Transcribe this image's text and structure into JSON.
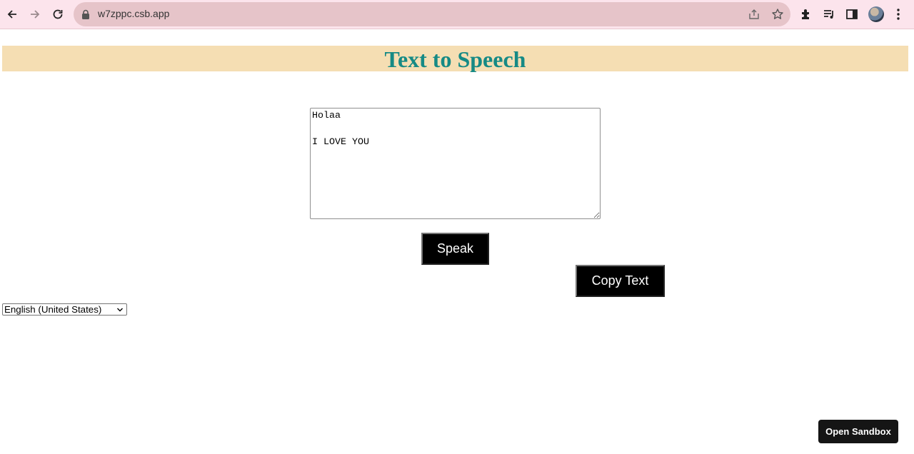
{
  "browser": {
    "url": "w7zppc.csb.app",
    "icons": [
      "back-arrow-icon",
      "forward-arrow-icon",
      "reload-icon",
      "lock-icon",
      "share-icon",
      "star-icon",
      "extensions-puzzle-icon",
      "media-queue-icon",
      "side-panel-icon",
      "profile-avatar",
      "kebab-menu-icon"
    ]
  },
  "page": {
    "title": "Text to Speech",
    "title_color": "#168a85",
    "title_bar_color": "#f5deb3",
    "textarea_value": "Holaa\n\nI LOVE YOU",
    "speak_label": "Speak",
    "copy_label": "Copy Text",
    "language": {
      "selected": "English (United States)"
    },
    "sandbox_label": "Open Sandbox"
  }
}
